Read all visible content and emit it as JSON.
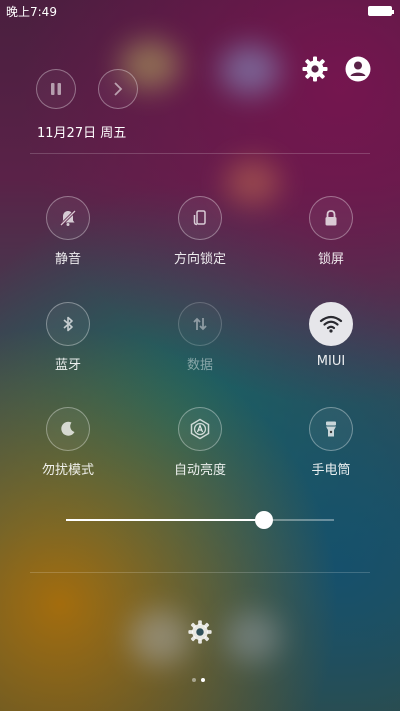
{
  "status_bar": {
    "time": "晚上7:49",
    "battery_icon": "battery-full-icon"
  },
  "header": {
    "pause_icon": "pause-icon",
    "next_icon": "chevron-right-icon",
    "settings_icon": "gear-icon",
    "account_icon": "account-icon",
    "date": "11月27日 周五"
  },
  "toggles": [
    {
      "label": "静音",
      "icon": "bell-off-icon",
      "state": "off"
    },
    {
      "label": "方向锁定",
      "icon": "rotation-lock-icon",
      "state": "off"
    },
    {
      "label": "锁屏",
      "icon": "lock-icon",
      "state": "off"
    },
    {
      "label": "蓝牙",
      "icon": "bluetooth-icon",
      "state": "off"
    },
    {
      "label": "数据",
      "icon": "mobile-data-icon",
      "state": "disabled"
    },
    {
      "label": "MIUI",
      "icon": "wifi-icon",
      "state": "on"
    },
    {
      "label": "勿扰模式",
      "icon": "moon-icon",
      "state": "off"
    },
    {
      "label": "自动亮度",
      "icon": "auto-brightness-icon",
      "state": "off"
    },
    {
      "label": "手电筒",
      "icon": "flashlight-icon",
      "state": "off"
    }
  ],
  "brightness": {
    "level": 0.74
  },
  "footer": {
    "settings_icon": "gear-icon",
    "page_indicator": {
      "pages": 2,
      "current": 2
    }
  },
  "colors": {
    "accent_active_tile": "#e6e6ea",
    "text": "#ffffff"
  }
}
